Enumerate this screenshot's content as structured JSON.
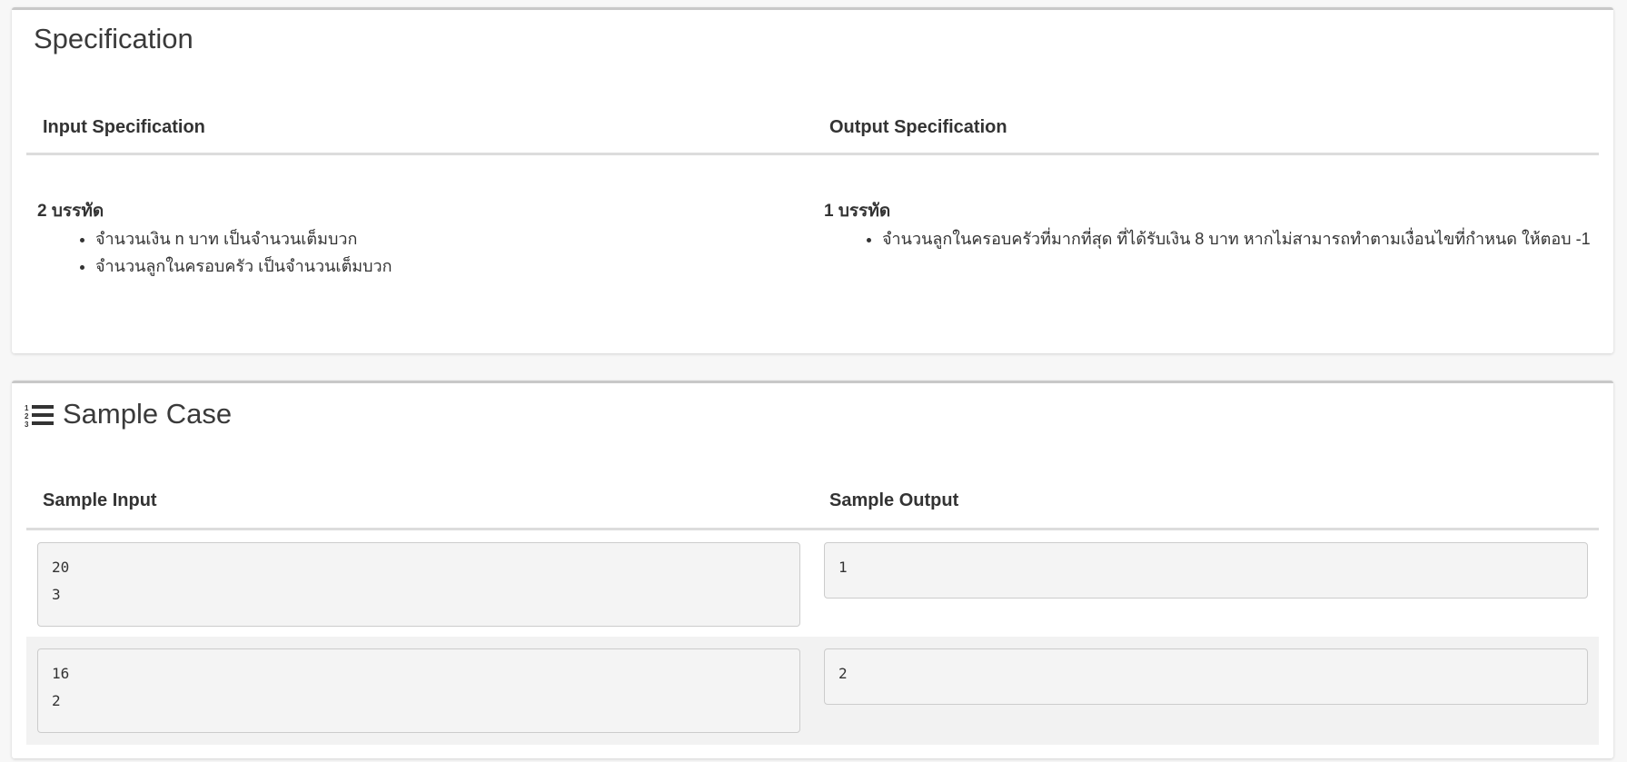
{
  "specification": {
    "title": "Specification",
    "input_header": "Input Specification",
    "output_header": "Output Specification",
    "input": {
      "heading": "2 บรรทัด",
      "items": [
        "จำนวนเงิน n บาท เป็นจำนวนเต็มบวก",
        "จำนวนลูกในครอบครัว เป็นจำนวนเต็มบวก"
      ]
    },
    "output": {
      "heading": "1 บรรทัด",
      "items": [
        "จำนวนลูกในครอบครัวที่มากที่สุด ที่ได้รับเงิน 8 บาท หากไม่สามารถทำตามเงื่อนไขที่กำหนด ให้ตอบ -1"
      ]
    }
  },
  "sample_case": {
    "title": "Sample Case",
    "icon": "list-ol-icon",
    "input_header": "Sample Input",
    "output_header": "Sample Output",
    "cases": [
      {
        "input": "20\n3",
        "output": "1"
      },
      {
        "input": "16\n2",
        "output": "2"
      }
    ]
  }
}
